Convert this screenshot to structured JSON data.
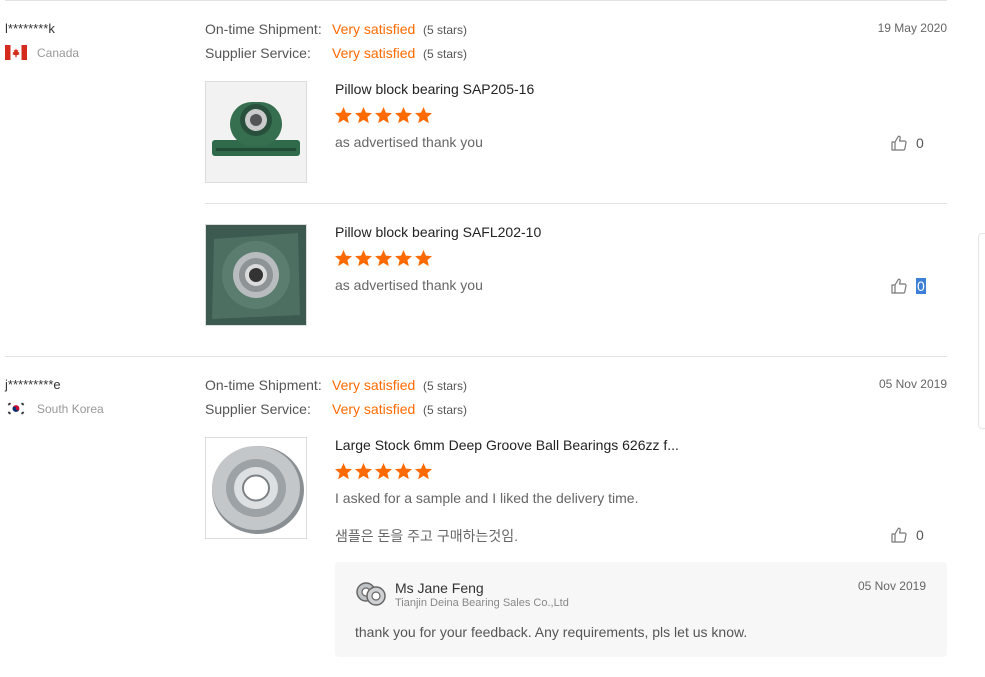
{
  "reviews": [
    {
      "buyer": "l********k",
      "country": "Canada",
      "ratings": {
        "shipment_label": "On-time Shipment:",
        "shipment_value": "Very satisfied",
        "shipment_stars": "(5 stars)",
        "service_label": "Supplier Service:",
        "service_value": "Very satisfied",
        "service_stars": "(5 stars)"
      },
      "date": "19 May 2020",
      "items": [
        {
          "title": "Pillow block bearing SAP205-16",
          "rating": 5,
          "text": "as advertised thank you",
          "helpful": "0"
        },
        {
          "title": "Pillow block bearing SAFL202-10",
          "rating": 5,
          "text": "as advertised thank you",
          "helpful": "0"
        }
      ]
    },
    {
      "buyer": "j*********e",
      "country": "South Korea",
      "ratings": {
        "shipment_label": "On-time Shipment:",
        "shipment_value": "Very satisfied",
        "shipment_stars": "(5 stars)",
        "service_label": "Supplier Service:",
        "service_value": "Very satisfied",
        "service_stars": "(5 stars)"
      },
      "date": "05 Nov 2019",
      "items": [
        {
          "title": "Large Stock 6mm Deep Groove Ball Bearings 626zz f...",
          "rating": 5,
          "text": "I asked for a sample and I liked the delivery time.",
          "text_translated": "샘플은 돈을 주고 구매하는것임.",
          "helpful": "0"
        }
      ],
      "reply": {
        "name": "Ms Jane Feng",
        "company": "Tianjin Deina Bearing Sales Co.,Ltd",
        "date": "05 Nov 2019",
        "text": "thank you for your feedback.  Any requirements, pls let us know."
      }
    }
  ],
  "colors": {
    "accent": "#ff6a00",
    "star": "#ff6a00",
    "divider": "#e3e3e3",
    "selection": "#3d7fd6"
  },
  "icons": {
    "flag_ca": "canada-flag-icon",
    "flag_kr": "south-korea-flag-icon",
    "star": "star-icon",
    "helpful": "thumbs-up-icon",
    "supplier": "bearing-avatar-icon"
  }
}
